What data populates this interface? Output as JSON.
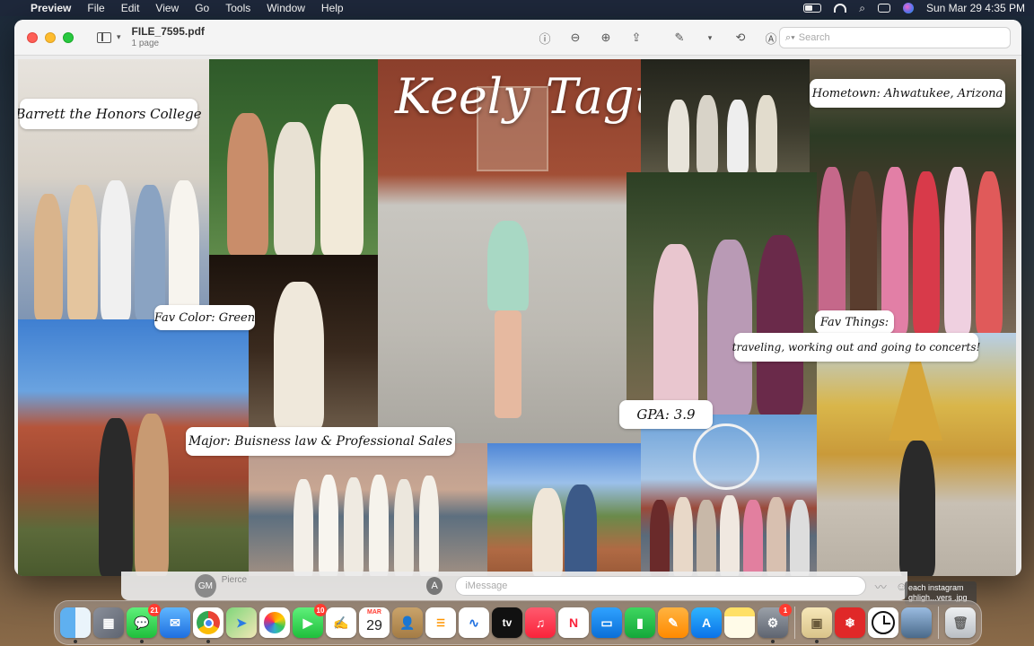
{
  "menubar": {
    "apple": "",
    "app_name": "Preview",
    "menus": [
      "File",
      "Edit",
      "View",
      "Go",
      "Tools",
      "Window",
      "Help"
    ],
    "datetime": "Sun Mar 29  4:35 PM"
  },
  "window": {
    "title": "FILE_7595.pdf",
    "subtitle": "1 page",
    "search_placeholder": "Search"
  },
  "collage": {
    "name": "Keely Tague",
    "labels": {
      "college": "Barrett the Honors College",
      "fav_color": "Fav Color: Green",
      "major": "Major: Buisness law & Professional Sales",
      "hometown": "Hometown: Ahwatukee, Arizona",
      "fav_things_title": "Fav Things:",
      "fav_things": "traveling, working out and going to concerts!",
      "gpa": "GPA: 3.9"
    }
  },
  "messages": {
    "avatar_initials": "GM",
    "contact_name": "Pierce",
    "input_placeholder": "iMessage"
  },
  "desktop_file": {
    "line1": "each instagram",
    "line2": "ghligh...vers .jpg"
  },
  "dock": {
    "messages_badge": "21",
    "facetime_badge": "10",
    "calendar_month": "MAR",
    "calendar_day": "29",
    "settings_badge": "1",
    "appletv_label": "tv"
  },
  "colors": {
    "accent_red": "#ff3b30",
    "window_bg": "#ececec"
  }
}
